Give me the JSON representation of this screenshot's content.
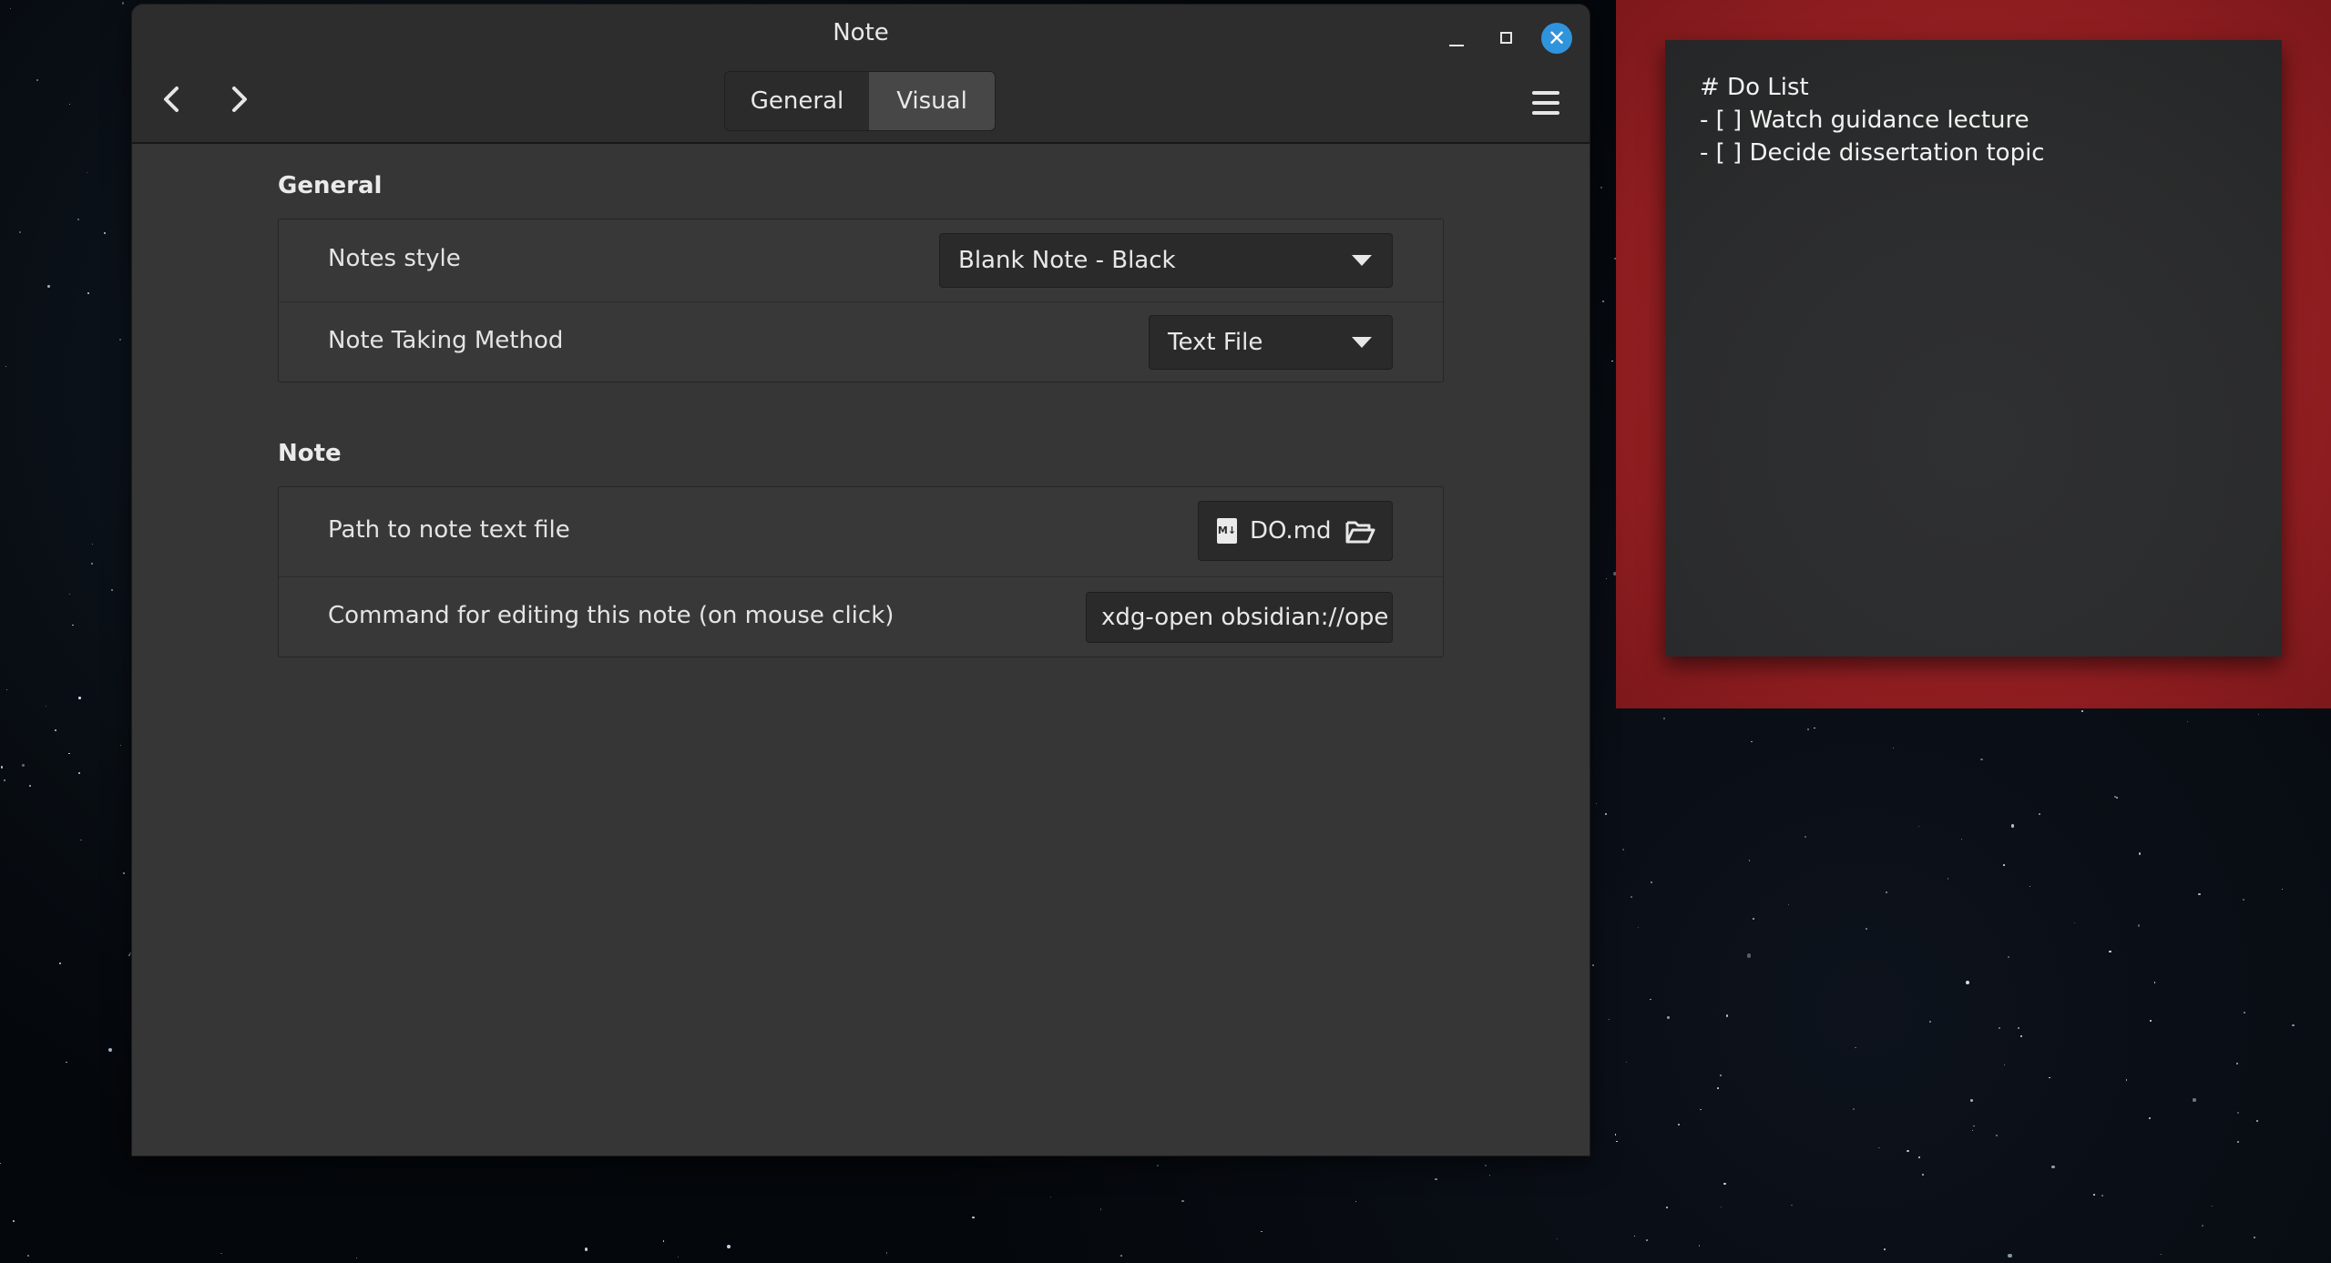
{
  "window": {
    "title": "Note",
    "tabs": [
      {
        "label": "General"
      },
      {
        "label": "Visual"
      }
    ],
    "active_tab": "Visual"
  },
  "sections": {
    "general": {
      "title": "General",
      "notes_style": {
        "label": "Notes style",
        "value": "Blank Note - Black"
      },
      "note_taking_method": {
        "label": "Note Taking Method",
        "value": "Text File"
      }
    },
    "note": {
      "title": "Note",
      "path": {
        "label": "Path to note text file",
        "file_name": "DO.md",
        "file_badge": "M↓"
      },
      "command": {
        "label": "Command for editing this note (on mouse click)",
        "value": "xdg-open obsidian://ope"
      }
    }
  },
  "desklet": {
    "lines": [
      "# Do List",
      "- [ ] Watch guidance lecture",
      "- [ ] Decide dissertation topic"
    ],
    "frame_color": "#8e1d20",
    "note_color": "#2b2c2d"
  },
  "icons": {
    "back": "chevron-left-icon",
    "forward": "chevron-right-icon",
    "menu": "hamburger-menu-icon",
    "minimize": "minimize-icon",
    "maximize": "maximize-icon",
    "close": "close-icon",
    "file": "markdown-file-icon",
    "folder": "folder-open-icon"
  },
  "colors": {
    "accent_close": "#3094dc",
    "window_bg": "#363636",
    "titlebar_bg": "#2d2d2d"
  }
}
